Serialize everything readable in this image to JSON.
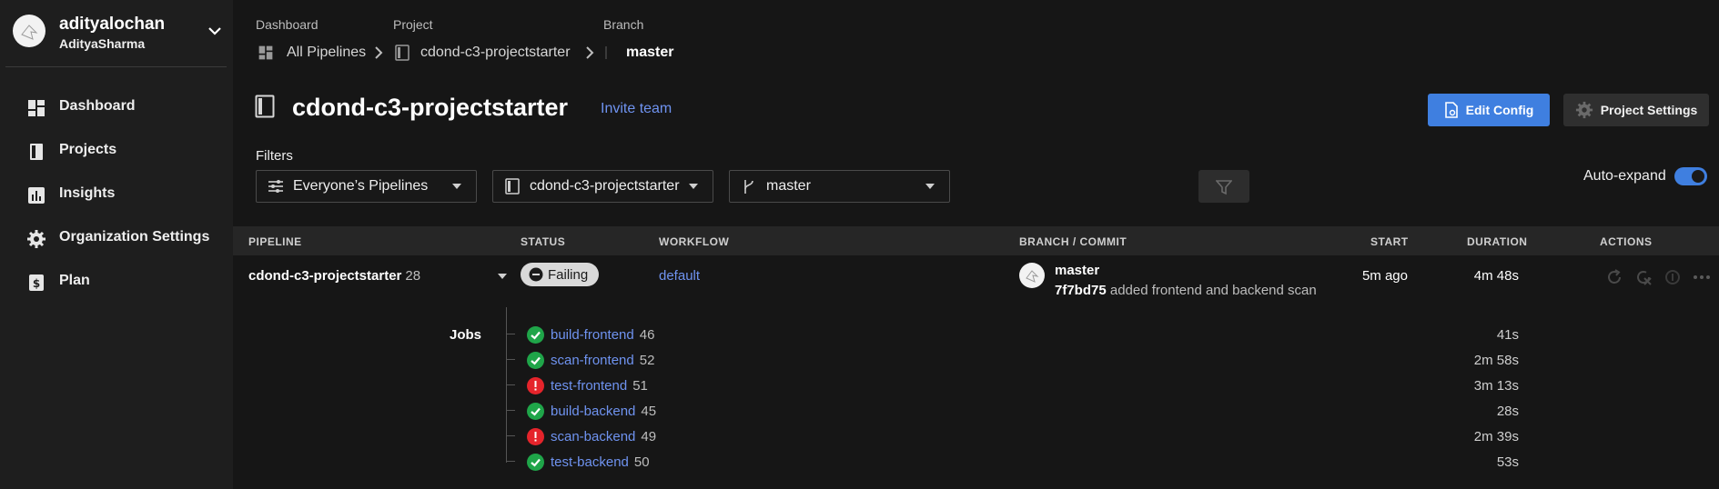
{
  "user": {
    "name": "adityalochan",
    "org": "AdityaSharma"
  },
  "nav": [
    {
      "label": "Dashboard",
      "icon": "dashboard-icon"
    },
    {
      "label": "Projects",
      "icon": "projects-icon"
    },
    {
      "label": "Insights",
      "icon": "insights-icon"
    },
    {
      "label": "Organization Settings",
      "icon": "gear-icon"
    },
    {
      "label": "Plan",
      "icon": "plan-dollar-icon"
    }
  ],
  "breadcrumb": {
    "dashboard_hdr": "Dashboard",
    "project_hdr": "Project",
    "branch_hdr": "Branch",
    "dashboard": "All Pipelines",
    "project": "cdond-c3-projectstarter",
    "branch": "master"
  },
  "page": {
    "title": "cdond-c3-projectstarter",
    "invite": "Invite team",
    "edit_config": "Edit Config",
    "project_settings": "Project Settings"
  },
  "filters": {
    "label": "Filters",
    "pipelines": "Everyone’s Pipelines",
    "project": "cdond-c3-projectstarter",
    "branch": "master",
    "autoexpand": "Auto-expand",
    "autoexpand_on": true
  },
  "table": {
    "headers": {
      "pipeline": "PIPELINE",
      "status": "STATUS",
      "workflow": "WORKFLOW",
      "branch_commit": "BRANCH / COMMIT",
      "start": "START",
      "duration": "DURATION",
      "actions": "ACTIONS"
    },
    "row": {
      "pipeline": "cdond-c3-projectstarter",
      "number": "28",
      "status": "Failing",
      "workflow": "default",
      "branch": "master",
      "commit_hash": "7f7bd75",
      "commit_msg": "added frontend and backend scan",
      "start": "5m ago",
      "duration": "4m 48s"
    }
  },
  "jobs": {
    "label": "Jobs",
    "items": [
      {
        "name": "build-frontend",
        "number": "46",
        "status": "success",
        "duration": "41s"
      },
      {
        "name": "scan-frontend",
        "number": "52",
        "status": "success",
        "duration": "2m 58s"
      },
      {
        "name": "test-frontend",
        "number": "51",
        "status": "failed",
        "duration": "3m 13s"
      },
      {
        "name": "build-backend",
        "number": "45",
        "status": "success",
        "duration": "28s"
      },
      {
        "name": "scan-backend",
        "number": "49",
        "status": "failed",
        "duration": "2m 39s"
      },
      {
        "name": "test-backend",
        "number": "50",
        "status": "success",
        "duration": "53s"
      }
    ]
  },
  "colors": {
    "accent": "#3f7fe0",
    "link": "#6f93f0",
    "success": "#1fa549",
    "failed": "#e5242b"
  }
}
